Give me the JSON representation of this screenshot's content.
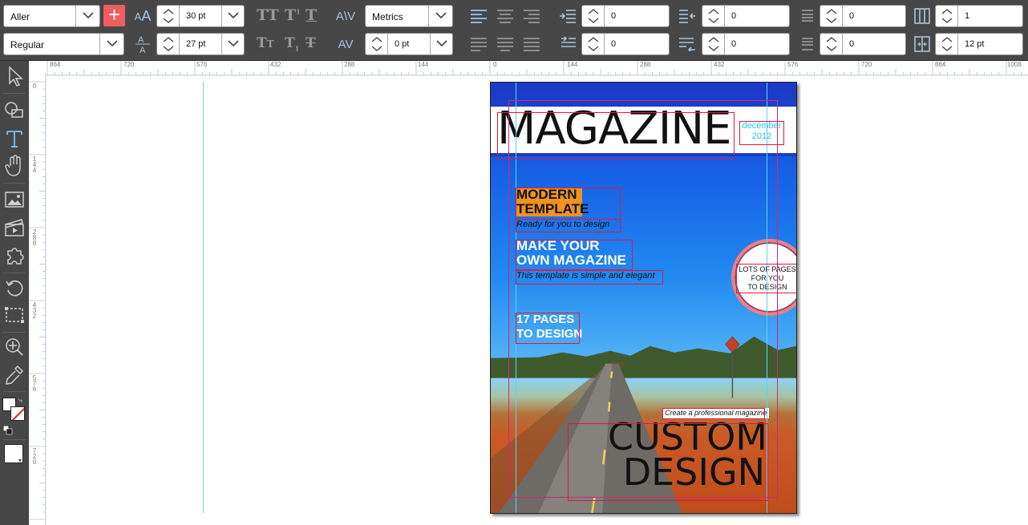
{
  "toolbar": {
    "font_family": "Aller",
    "font_style": "Regular",
    "font_size": "30 pt",
    "leading": "27 pt",
    "kerning": "Metrics",
    "tracking": "0 pt",
    "add_label": "+",
    "case_glyphs": [
      "TT",
      "T",
      "T",
      "Tt",
      "T",
      "T"
    ],
    "kern_glyph": "A\\V",
    "track_glyph": "AV",
    "size_glyph": "AA",
    "leading_glyph": "A",
    "indent_left": "0",
    "indent_first": "0",
    "indent_right": "0",
    "indent_last": "0",
    "space_before": "0",
    "space_after": "0",
    "columns": "1",
    "gutter": "12 pt"
  },
  "rulers": {
    "horizontal": [
      "864",
      "720",
      "576",
      "432",
      "288",
      "144",
      "0",
      "144",
      "288",
      "432",
      "576",
      "720",
      "864",
      "1008"
    ],
    "vertical": [
      "0",
      "1 4 4",
      "2 8 8",
      "4 3 2",
      "5 7 6",
      "7 2 0"
    ]
  },
  "cover": {
    "masthead": "MAGAZINE",
    "date_line1": "december",
    "date_line2": "2012",
    "headline1_line1": "MODERN",
    "headline1_line2": "TEMPLATE",
    "sub1": "Ready for you to design",
    "headline2_line1": "MAKE YOUR",
    "headline2_line2": "OWN MAGAZINE",
    "sub2": "This template is simple and elegant",
    "headline3_line1": "17 PAGES",
    "headline3_line2": "TO DESIGN",
    "badge_line1": "LOTS OF PAGES",
    "badge_line2": "FOR YOU",
    "badge_line3": "TO DESIGN",
    "tagline": "Create a professional magazine",
    "big_line1": "CUSTOM",
    "big_line2": "DESIGN"
  },
  "colors": {
    "accent_red": "#ef5d5d",
    "orange_highlight": "#f0921e",
    "date_cyan": "#27c3ea",
    "guide_cyan": "#79d3f2"
  }
}
